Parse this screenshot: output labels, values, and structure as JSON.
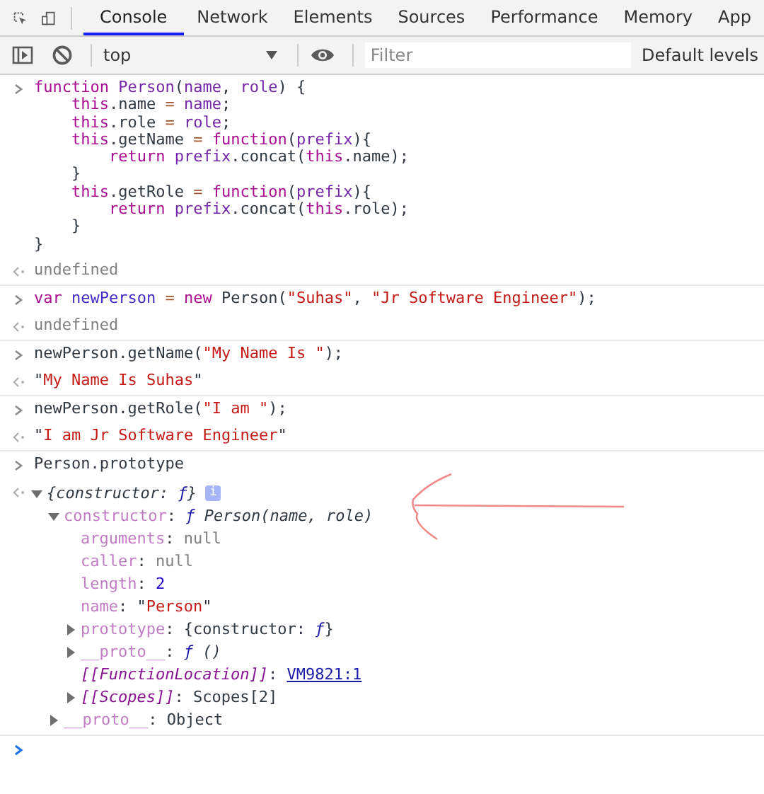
{
  "tabs": [
    {
      "label": "Console",
      "selected": true
    },
    {
      "label": "Network",
      "selected": false
    },
    {
      "label": "Elements",
      "selected": false
    },
    {
      "label": "Sources",
      "selected": false
    },
    {
      "label": "Performance",
      "selected": false
    },
    {
      "label": "Memory",
      "selected": false
    },
    {
      "label": "App",
      "selected": false
    }
  ],
  "toolbar": {
    "context": "top",
    "filter": {
      "placeholder": "Filter"
    },
    "levels": "Default levels"
  },
  "messages": [
    {
      "kind": "input",
      "lines": [
        [
          {
            "kind": "kw",
            "text": "function "
          },
          {
            "kind": "def",
            "text": "Person"
          },
          {
            "kind": "plain",
            "text": "("
          },
          {
            "kind": "def",
            "text": "name"
          },
          {
            "kind": "plain",
            "text": ", "
          },
          {
            "kind": "def",
            "text": "role"
          },
          {
            "kind": "plain",
            "text": ") {"
          }
        ],
        [
          {
            "kind": "kw",
            "text": "    this"
          },
          {
            "kind": "plain",
            "text": ".name "
          },
          {
            "kind": "op",
            "text": "= "
          },
          {
            "kind": "def",
            "text": "name"
          },
          {
            "kind": "plain",
            "text": ";"
          }
        ],
        [
          {
            "kind": "kw",
            "text": "    this"
          },
          {
            "kind": "plain",
            "text": ".role "
          },
          {
            "kind": "op",
            "text": "= "
          },
          {
            "kind": "def",
            "text": "role"
          },
          {
            "kind": "plain",
            "text": ";"
          }
        ],
        [
          {
            "kind": "kw",
            "text": "    this"
          },
          {
            "kind": "plain",
            "text": ".getName "
          },
          {
            "kind": "op",
            "text": "= "
          },
          {
            "kind": "kw",
            "text": "function"
          },
          {
            "kind": "plain",
            "text": "("
          },
          {
            "kind": "def",
            "text": "prefix"
          },
          {
            "kind": "plain",
            "text": "){"
          }
        ],
        [
          {
            "kind": "kw",
            "text": "        return "
          },
          {
            "kind": "def",
            "text": "prefix"
          },
          {
            "kind": "plain",
            "text": ".concat("
          },
          {
            "kind": "kw",
            "text": "this"
          },
          {
            "kind": "plain",
            "text": ".name);"
          }
        ],
        [
          {
            "kind": "plain",
            "text": "    }"
          }
        ],
        [
          {
            "kind": "kw",
            "text": "    this"
          },
          {
            "kind": "plain",
            "text": ".getRole "
          },
          {
            "kind": "op",
            "text": "= "
          },
          {
            "kind": "kw",
            "text": "function"
          },
          {
            "kind": "plain",
            "text": "("
          },
          {
            "kind": "def",
            "text": "prefix"
          },
          {
            "kind": "plain",
            "text": "){"
          }
        ],
        [
          {
            "kind": "kw",
            "text": "        return "
          },
          {
            "kind": "def",
            "text": "prefix"
          },
          {
            "kind": "plain",
            "text": ".concat("
          },
          {
            "kind": "kw",
            "text": "this"
          },
          {
            "kind": "plain",
            "text": ".role);"
          }
        ],
        [
          {
            "kind": "plain",
            "text": "    }"
          }
        ],
        [
          {
            "kind": "plain",
            "text": "}"
          }
        ]
      ]
    },
    {
      "kind": "output",
      "lines": [
        [
          {
            "kind": "undef",
            "text": "undefined"
          }
        ]
      ]
    },
    {
      "kind": "input",
      "lines": [
        [
          {
            "kind": "kw",
            "text": "var "
          },
          {
            "kind": "var",
            "text": "newPerson "
          },
          {
            "kind": "op",
            "text": "= "
          },
          {
            "kind": "kw",
            "text": "new "
          },
          {
            "kind": "plain",
            "text": "Person("
          },
          {
            "kind": "str",
            "text": "\"Suhas\""
          },
          {
            "kind": "plain",
            "text": ", "
          },
          {
            "kind": "str",
            "text": "\"Jr Software Engineer\""
          },
          {
            "kind": "plain",
            "text": ");"
          }
        ]
      ]
    },
    {
      "kind": "output",
      "lines": [
        [
          {
            "kind": "undef",
            "text": "undefined"
          }
        ]
      ]
    },
    {
      "kind": "input",
      "lines": [
        [
          {
            "kind": "plain",
            "text": "newPerson.getName("
          },
          {
            "kind": "str",
            "text": "\"My Name Is \""
          },
          {
            "kind": "plain",
            "text": ");"
          }
        ]
      ]
    },
    {
      "kind": "output",
      "lines": [
        [
          {
            "kind": "plain",
            "text": "\""
          },
          {
            "kind": "str",
            "text": "My Name Is Suhas"
          },
          {
            "kind": "plain",
            "text": "\""
          }
        ]
      ]
    },
    {
      "kind": "input",
      "lines": [
        [
          {
            "kind": "plain",
            "text": "newPerson.getRole("
          },
          {
            "kind": "str",
            "text": "\"I am \""
          },
          {
            "kind": "plain",
            "text": ");"
          }
        ]
      ]
    },
    {
      "kind": "output",
      "lines": [
        [
          {
            "kind": "plain",
            "text": "\""
          },
          {
            "kind": "str",
            "text": "I am Jr Software Engineer"
          },
          {
            "kind": "plain",
            "text": "\""
          }
        ]
      ]
    },
    {
      "kind": "input",
      "lines": [
        [
          {
            "kind": "plain",
            "text": "Person.prototype"
          }
        ]
      ]
    },
    {
      "kind": "tree",
      "root": {
        "expanded": true,
        "badge": "i",
        "value": [
          {
            "kind": "italic",
            "text": "{constructor: "
          },
          {
            "kind": "fn",
            "text": "ƒ"
          },
          {
            "kind": "italic",
            "text": "}"
          }
        ],
        "children": [
          {
            "key": "constructor",
            "kind": "property",
            "expanded": true,
            "value": [
              {
                "kind": "plain",
                "text": ": "
              },
              {
                "kind": "fn",
                "text": "ƒ"
              },
              {
                "kind": "italic",
                "text": " Person(name, role)"
              }
            ],
            "children": [
              {
                "key": "arguments",
                "kind": "property",
                "value": [
                  {
                    "kind": "plain",
                    "text": ": "
                  },
                  {
                    "kind": "undef",
                    "text": "null"
                  }
                ]
              },
              {
                "key": "caller",
                "kind": "property",
                "value": [
                  {
                    "kind": "plain",
                    "text": ": "
                  },
                  {
                    "kind": "undef",
                    "text": "null"
                  }
                ]
              },
              {
                "key": "length",
                "kind": "property",
                "value": [
                  {
                    "kind": "plain",
                    "text": ": "
                  },
                  {
                    "kind": "num",
                    "text": "2"
                  }
                ]
              },
              {
                "key": "name",
                "kind": "property",
                "value": [
                  {
                    "kind": "plain",
                    "text": ": \""
                  },
                  {
                    "kind": "str",
                    "text": "Person"
                  },
                  {
                    "kind": "plain",
                    "text": "\""
                  }
                ]
              },
              {
                "key": "prototype",
                "kind": "property",
                "expanded": false,
                "value": [
                  {
                    "kind": "plain",
                    "text": ": {constructor: "
                  },
                  {
                    "kind": "fn",
                    "text": "ƒ"
                  },
                  {
                    "kind": "plain",
                    "text": "}"
                  }
                ]
              },
              {
                "key": "__proto__",
                "kind": "property",
                "expanded": false,
                "value": [
                  {
                    "kind": "plain",
                    "text": ": "
                  },
                  {
                    "kind": "fn",
                    "text": "ƒ"
                  },
                  {
                    "kind": "italic",
                    "text": " ()"
                  }
                ]
              },
              {
                "key": "[[FunctionLocation]]",
                "kind": "internal",
                "value": [
                  {
                    "kind": "plain",
                    "text": ": "
                  },
                  {
                    "kind": "link",
                    "text": "VM9821:1"
                  }
                ]
              },
              {
                "key": "[[Scopes]]",
                "kind": "internal",
                "expanded": false,
                "value": [
                  {
                    "kind": "plain",
                    "text": ": Scopes[2]"
                  }
                ]
              }
            ]
          },
          {
            "key": "__proto__",
            "kind": "property",
            "expanded": false,
            "value": [
              {
                "kind": "plain",
                "text": ": Object"
              }
            ]
          }
        ]
      }
    },
    {
      "kind": "prompt"
    }
  ]
}
